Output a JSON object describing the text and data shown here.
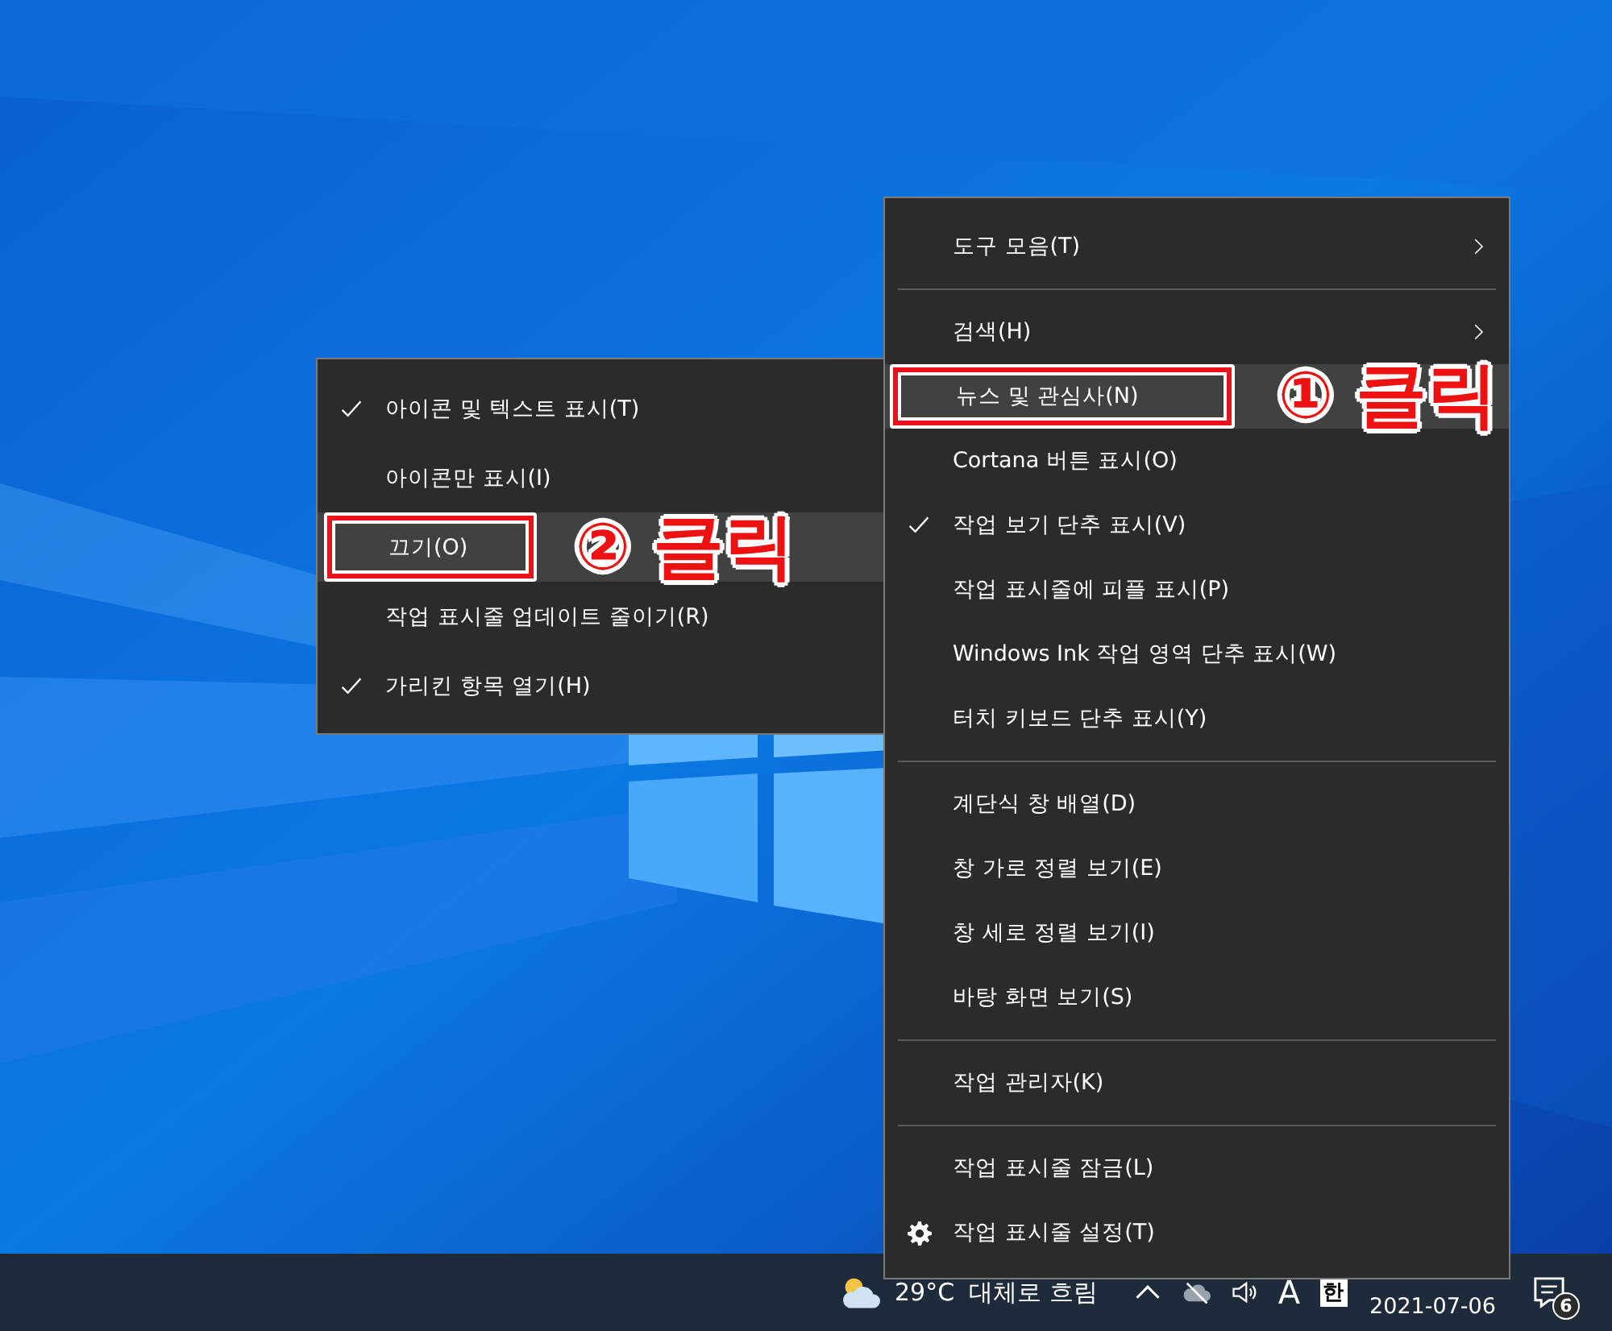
{
  "context_menu": {
    "items": [
      {
        "kind": "item",
        "label": "도구 모음(T)",
        "has_submenu": true,
        "checked": false,
        "selected": false
      },
      {
        "kind": "separator"
      },
      {
        "kind": "item",
        "label": "검색(H)",
        "has_submenu": true,
        "checked": false,
        "selected": false
      },
      {
        "kind": "item",
        "label": "뉴스 및 관심사(N)",
        "has_submenu": false,
        "checked": false,
        "selected": true,
        "annotation": {
          "number": "①",
          "label": "클릭"
        }
      },
      {
        "kind": "item",
        "label": "Cortana 버튼 표시(O)",
        "has_submenu": false,
        "checked": false,
        "selected": false
      },
      {
        "kind": "item",
        "label": "작업 보기 단추 표시(V)",
        "has_submenu": false,
        "checked": true,
        "selected": false
      },
      {
        "kind": "item",
        "label": "작업 표시줄에 피플 표시(P)",
        "has_submenu": false,
        "checked": false,
        "selected": false
      },
      {
        "kind": "item",
        "label": "Windows Ink 작업 영역 단추 표시(W)",
        "has_submenu": false,
        "checked": false,
        "selected": false
      },
      {
        "kind": "item",
        "label": "터치 키보드 단추 표시(Y)",
        "has_submenu": false,
        "checked": false,
        "selected": false
      },
      {
        "kind": "separator"
      },
      {
        "kind": "item",
        "label": "계단식 창 배열(D)",
        "has_submenu": false,
        "checked": false,
        "selected": false
      },
      {
        "kind": "item",
        "label": "창 가로 정렬 보기(E)",
        "has_submenu": false,
        "checked": false,
        "selected": false
      },
      {
        "kind": "item",
        "label": "창 세로 정렬 보기(I)",
        "has_submenu": false,
        "checked": false,
        "selected": false
      },
      {
        "kind": "item",
        "label": "바탕 화면 보기(S)",
        "has_submenu": false,
        "checked": false,
        "selected": false
      },
      {
        "kind": "separator"
      },
      {
        "kind": "item",
        "label": "작업 관리자(K)",
        "has_submenu": false,
        "checked": false,
        "selected": false
      },
      {
        "kind": "separator"
      },
      {
        "kind": "item",
        "label": "작업 표시줄 잠금(L)",
        "has_submenu": false,
        "checked": false,
        "selected": false
      },
      {
        "kind": "settings-item",
        "label": "작업 표시줄 설정(T)",
        "has_submenu": false,
        "checked": false,
        "selected": false
      }
    ]
  },
  "submenu": {
    "items": [
      {
        "kind": "item",
        "label": "아이콘 및 텍스트 표시(T)",
        "checked": true,
        "selected": false
      },
      {
        "kind": "item",
        "label": "아이콘만 표시(I)",
        "checked": false,
        "selected": false
      },
      {
        "kind": "item",
        "label": "끄기(O)",
        "checked": false,
        "selected": true,
        "annotation": {
          "number": "②",
          "label": "클릭"
        }
      },
      {
        "kind": "item",
        "label": "작업 표시줄 업데이트 줄이기(R)",
        "checked": false,
        "selected": false
      },
      {
        "kind": "item",
        "label": "가리킨 항목 열기(H)",
        "checked": true,
        "selected": false
      }
    ]
  },
  "taskbar": {
    "weather": {
      "temperature": "29°C",
      "condition": "대체로 흐림"
    },
    "date": "2021-07-06",
    "notification_count": "6",
    "ime": "한",
    "font_indicator": "A"
  }
}
